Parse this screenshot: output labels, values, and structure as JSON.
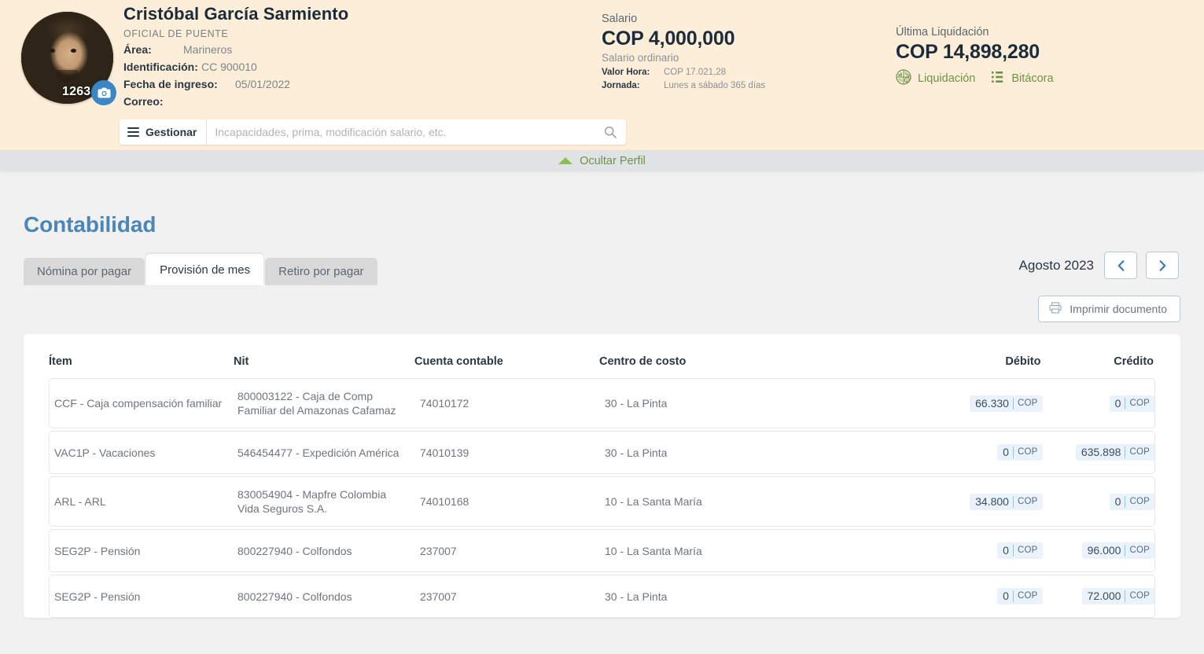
{
  "profile": {
    "avatar_count": "1263",
    "name": "Cristóbal García Sarmiento",
    "role": "OFICIAL DE PUENTE",
    "fields": [
      {
        "key": "Área:",
        "value": "Marineros"
      },
      {
        "key": "Identificación:",
        "value": "CC 900010"
      },
      {
        "key": "Fecha de ingreso:",
        "value": "05/01/2022"
      },
      {
        "key": "Correo:",
        "value": ""
      }
    ],
    "manage_button": "Gestionar",
    "search_placeholder": "Incapacidades, prima, modificación salario, etc.",
    "search_value": ""
  },
  "salary": {
    "label": "Salario",
    "amount": "COP 4,000,000",
    "sub": "Salario ordinario",
    "hour_key": "Valor Hora:",
    "hour_value": "COP 17.021,28",
    "shift_key": "Jornada:",
    "shift_value": "Lunes a sábado 365 días"
  },
  "settlement": {
    "label": "Última Liquidación",
    "amount": "COP 14,898,280",
    "link_liquidacion": "Liquidación",
    "link_bitacora": "Bitácora"
  },
  "hide_profile": {
    "label": "Ocultar Perfil"
  },
  "page": {
    "title": "Contabilidad",
    "month": "Agosto 2023",
    "prev_label": "‹",
    "next_label": "›",
    "print_label": "Imprimir documento"
  },
  "tabs": [
    {
      "label": "Nómina por pagar",
      "active": false
    },
    {
      "label": "Provisión de mes",
      "active": true
    },
    {
      "label": "Retiro por pagar",
      "active": false
    }
  ],
  "table": {
    "headers": {
      "item": "Ítem",
      "nit": "Nit",
      "account": "Cuenta contable",
      "cost_center": "Centro de costo",
      "debit": "Débito",
      "credit": "Crédito"
    },
    "currency": "COP",
    "rows": [
      {
        "item": "CCF - Caja compensación familiar",
        "nit": "800003122 - Caja de Comp Familiar del Amazonas Cafamaz",
        "account": "74010172",
        "cost_center": "30 - La Pinta",
        "debit": "66.330",
        "credit": "0"
      },
      {
        "item": "VAC1P - Vacaciones",
        "nit": "546454477 - Expedición América",
        "account": "74010139",
        "cost_center": "30 - La Pinta",
        "debit": "0",
        "credit": "635.898"
      },
      {
        "item": "ARL - ARL",
        "nit": "830054904 - Mapfre Colombia Vida Seguros S.A.",
        "account": "74010168",
        "cost_center": "10 - La Santa María",
        "debit": "34.800",
        "credit": "0"
      },
      {
        "item": "SEG2P - Pensión",
        "nit": "800227940 - Colfondos",
        "account": "237007",
        "cost_center": "10 - La Santa María",
        "debit": "0",
        "credit": "96.000"
      },
      {
        "item": "SEG2P - Pensión",
        "nit": "800227940 - Colfondos",
        "account": "237007",
        "cost_center": "30 - La Pinta",
        "debit": "0",
        "credit": "72.000"
      }
    ]
  },
  "colors": {
    "header_bg": "#fceed8",
    "accent_blue": "#4a86b8",
    "accent_green": "#6f9146",
    "badge_bg": "#eaf3fb"
  }
}
